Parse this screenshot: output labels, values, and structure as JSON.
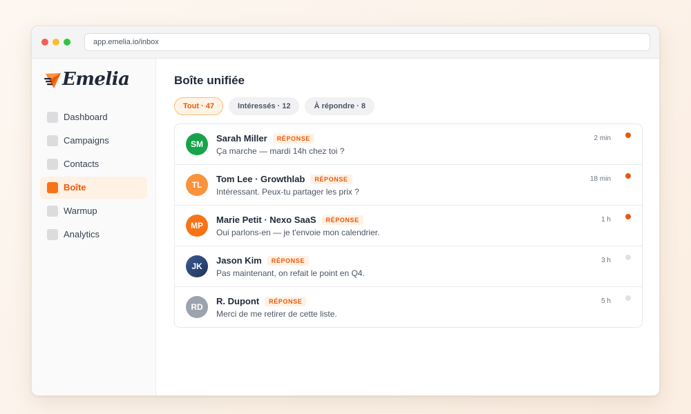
{
  "browser": {
    "url": "app.emelia.io/inbox"
  },
  "app": {
    "logo_text": "Emelia",
    "brand_color": "#f97316"
  },
  "sidebar": {
    "items": [
      {
        "label": "Dashboard",
        "active": false
      },
      {
        "label": "Campaigns",
        "active": false
      },
      {
        "label": "Contacts",
        "active": false
      },
      {
        "label": "Boîte",
        "active": true
      },
      {
        "label": "Warmup",
        "active": false
      },
      {
        "label": "Analytics",
        "active": false
      }
    ]
  },
  "main": {
    "title": "Boîte unifiée",
    "filters": [
      {
        "label": "Tout · 47",
        "active": true
      },
      {
        "label": "Intéressés · 12",
        "active": false
      },
      {
        "label": "À répondre · 8",
        "active": false
      }
    ],
    "messages": [
      {
        "initials": "SM",
        "name": "Sarah Miller",
        "badge": "RÉPONSE",
        "preview": "Ça marche — mardi 14h chez toi ?",
        "time": "2 min",
        "unread": true,
        "avatar_color": "#16a34a"
      },
      {
        "initials": "TL",
        "name": "Tom Lee · Growthlab",
        "badge": "RÉPONSE",
        "preview": "Intéressant. Peux-tu partager les prix ?",
        "time": "18 min",
        "unread": true,
        "avatar_color": "#fb923c"
      },
      {
        "initials": "MP",
        "name": "Marie Petit · Nexo SaaS",
        "badge": "RÉPONSE",
        "preview": "Oui parlons-en — je t'envoie mon calendrier.",
        "time": "1 h",
        "unread": true,
        "avatar_color": "#f97316"
      },
      {
        "initials": "JK",
        "name": "Jason Kim",
        "badge": "RÉPONSE",
        "preview": "Pas maintenant, on refait le point en Q4.",
        "time": "3 h",
        "unread": false,
        "avatar_color": "#2d4a7a"
      },
      {
        "initials": "RD",
        "name": "R. Dupont",
        "badge": "RÉPONSE",
        "preview": "Merci de me retirer de cette liste.",
        "time": "5 h",
        "unread": false,
        "avatar_color": "#9ca3af"
      }
    ]
  },
  "colors": {
    "unread_dot": "#ea580c",
    "read_dot": "#e2e2e5"
  }
}
